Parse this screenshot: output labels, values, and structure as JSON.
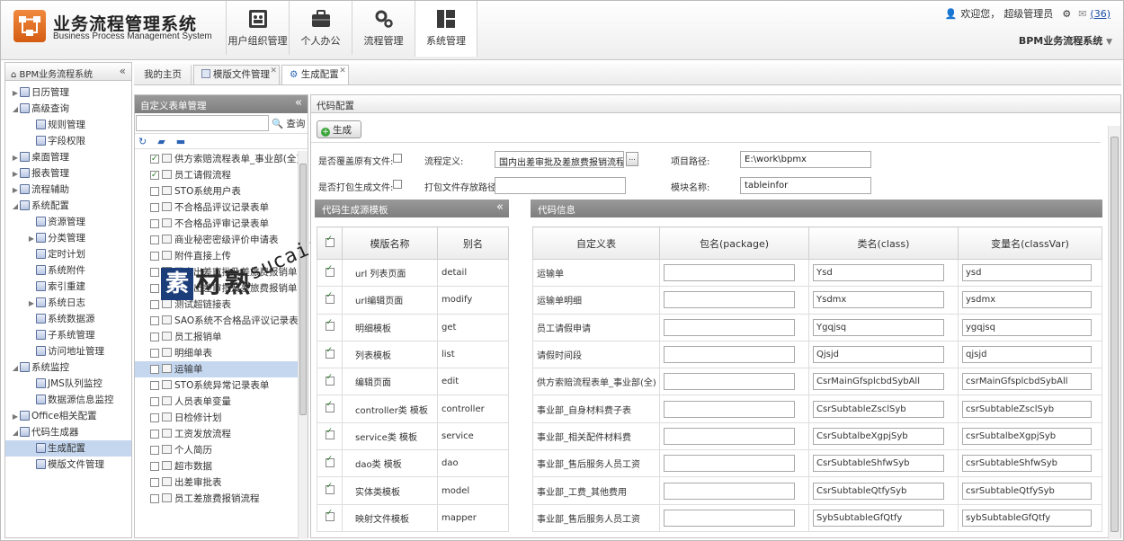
{
  "header": {
    "title": "业务流程管理系统",
    "subtitle": "Business Process Management System",
    "nav": [
      {
        "label": "用户组织管理",
        "icon": "users-grid-icon"
      },
      {
        "label": "个人办公",
        "icon": "briefcase-icon"
      },
      {
        "label": "流程管理",
        "icon": "gears-icon"
      },
      {
        "label": "系统管理",
        "icon": "layout-icon"
      }
    ],
    "user": {
      "welcome": "欢迎您，",
      "name": "超级管理员",
      "mail_count": "(36)"
    },
    "system_name": "BPM业务流程系统"
  },
  "sidebar": {
    "title": "BPM业务流程系统",
    "items": [
      {
        "label": "日历管理",
        "level": 1,
        "arrow": "▶"
      },
      {
        "label": "高级查询",
        "level": 1,
        "arrow": "◢"
      },
      {
        "label": "规则管理",
        "level": 2,
        "arrow": ""
      },
      {
        "label": "字段权限",
        "level": 2,
        "arrow": ""
      },
      {
        "label": "桌面管理",
        "level": 1,
        "arrow": "▶"
      },
      {
        "label": "报表管理",
        "level": 1,
        "arrow": "▶"
      },
      {
        "label": "流程辅助",
        "level": 1,
        "arrow": "▶"
      },
      {
        "label": "系统配置",
        "level": 1,
        "arrow": "◢"
      },
      {
        "label": "资源管理",
        "level": 2,
        "arrow": ""
      },
      {
        "label": "分类管理",
        "level": 2,
        "arrow": "▶"
      },
      {
        "label": "定时计划",
        "level": 2,
        "arrow": ""
      },
      {
        "label": "系统附件",
        "level": 2,
        "arrow": ""
      },
      {
        "label": "索引重建",
        "level": 2,
        "arrow": ""
      },
      {
        "label": "系统日志",
        "level": 2,
        "arrow": "▶"
      },
      {
        "label": "系统数据源",
        "level": 2,
        "arrow": ""
      },
      {
        "label": "子系统管理",
        "level": 2,
        "arrow": ""
      },
      {
        "label": "访问地址管理",
        "level": 2,
        "arrow": ""
      },
      {
        "label": "系统监控",
        "level": 1,
        "arrow": "◢"
      },
      {
        "label": "JMS队列监控",
        "level": 2,
        "arrow": ""
      },
      {
        "label": "数据源信息监控",
        "level": 2,
        "arrow": ""
      },
      {
        "label": "Office相关配置",
        "level": 1,
        "arrow": "▶"
      },
      {
        "label": "代码生成器",
        "level": 1,
        "arrow": "◢"
      },
      {
        "label": "生成配置",
        "level": 2,
        "arrow": "",
        "selected": true
      },
      {
        "label": "模版文件管理",
        "level": 2,
        "arrow": ""
      }
    ]
  },
  "tabs": [
    {
      "label": "我的主页"
    },
    {
      "label": "模版文件管理"
    },
    {
      "label": "生成配置"
    }
  ],
  "form_panel": {
    "title": "自定义表单管理",
    "search_button": "查询",
    "items": [
      {
        "label": "供方索赔流程表单_事业部(全)",
        "checked": true
      },
      {
        "label": "员工请假流程",
        "checked": true
      },
      {
        "label": "STO系统用户表",
        "checked": false
      },
      {
        "label": "不合格品评议记录表单",
        "checked": false
      },
      {
        "label": "不合格品评审记录表单",
        "checked": false
      },
      {
        "label": "商业秘密密级评价申请表",
        "checked": false
      },
      {
        "label": "附件直接上传",
        "checked": false
      },
      {
        "label": "国内出差审批及差旅费报销单",
        "checked": false
      },
      {
        "label": "国内出差审批及差旅费报销单事业",
        "checked": false
      },
      {
        "label": "测试超链接表",
        "checked": false
      },
      {
        "label": "SAO系统不合格品评议记录表单",
        "checked": false
      },
      {
        "label": "员工报销单",
        "checked": false
      },
      {
        "label": "明细单表",
        "checked": false
      },
      {
        "label": "运输单",
        "checked": false,
        "selected": true
      },
      {
        "label": "STO系统异常记录表单",
        "checked": false
      },
      {
        "label": "人员表单变量",
        "checked": false
      },
      {
        "label": "日检修计划",
        "checked": false
      },
      {
        "label": "工资发放流程",
        "checked": false
      },
      {
        "label": "个人简历",
        "checked": false
      },
      {
        "label": "超市数据",
        "checked": false
      },
      {
        "label": "出差审批表",
        "checked": false
      },
      {
        "label": "员工差旅费报销流程",
        "checked": false
      }
    ]
  },
  "watermark": {
    "brand": "素材熟",
    "badge": "素",
    "url": "sucaire.com"
  },
  "main": {
    "title": "代码配置",
    "generate_button": "生成",
    "labels": {
      "overwrite": "是否覆盖原有文件:",
      "pack": "是否打包生成文件:",
      "flow_def": "流程定义:",
      "pack_path": "打包文件存放路径:",
      "project_path": "项目路径:",
      "module_name": "模块名称:"
    },
    "values": {
      "flow_def": "国内出差审批及差旅费报销流程",
      "flow_def_btn": "...",
      "pack_path": "",
      "project_path": "E:\\work\\bpmx",
      "module_name": "tableinfor"
    },
    "template_panel": {
      "title": "代码生成源模板",
      "headers": {
        "name": "模版名称",
        "alias": "别名"
      },
      "rows": [
        {
          "name": "url 列表页面",
          "alias": "detail"
        },
        {
          "name": "url编辑页面",
          "alias": "modify"
        },
        {
          "name": "明细模板",
          "alias": "get"
        },
        {
          "name": "列表模板",
          "alias": "list"
        },
        {
          "name": "编辑页面",
          "alias": "edit"
        },
        {
          "name": "controller类 模板",
          "alias": "controller"
        },
        {
          "name": "service类 模板",
          "alias": "service"
        },
        {
          "name": "dao类 模板",
          "alias": "dao"
        },
        {
          "name": "实体类模板",
          "alias": "model"
        },
        {
          "name": "映射文件模板",
          "alias": "mapper"
        }
      ]
    },
    "code_info": {
      "title": "代码信息",
      "headers": {
        "table": "自定义表",
        "package": "包名(package)",
        "class": "类名(class)",
        "var": "变量名(classVar)"
      },
      "rows": [
        {
          "table": "运输单",
          "package": "",
          "class": "Ysd",
          "var": "ysd"
        },
        {
          "table": "运输单明细",
          "package": "",
          "class": "Ysdmx",
          "var": "ysdmx"
        },
        {
          "table": "员工请假申请",
          "package": "",
          "class": "Ygqjsq",
          "var": "ygqjsq"
        },
        {
          "table": "请假时间段",
          "package": "",
          "class": "Qjsjd",
          "var": "qjsjd"
        },
        {
          "table": "供方索赔流程表单_事业部(全)",
          "package": "",
          "class": "CsrMainGfsplcbdSybAll",
          "var": "csrMainGfsplcbdSybAll"
        },
        {
          "table": "事业部_自身材料费子表",
          "package": "",
          "class": "CsrSubtableZsclSyb",
          "var": "csrSubtableZsclSyb"
        },
        {
          "table": "事业部_相关配件材料费",
          "package": "",
          "class": "CsrSubtalbeXgpjSyb",
          "var": "csrSubtalbeXgpjSyb"
        },
        {
          "table": "事业部_售后服务人员工资",
          "package": "",
          "class": "CsrSubtableShfwSyb",
          "var": "csrSubtableShfwSyb"
        },
        {
          "table": "事业部_工费_其他费用",
          "package": "",
          "class": "CsrSubtableQtfySyb",
          "var": "csrSubtableQtfySyb"
        },
        {
          "table": "事业部_售后服务人员工资",
          "package": "",
          "class": "SybSubtableGfQtfy",
          "var": "sybSubtableGfQtfy"
        }
      ]
    }
  }
}
